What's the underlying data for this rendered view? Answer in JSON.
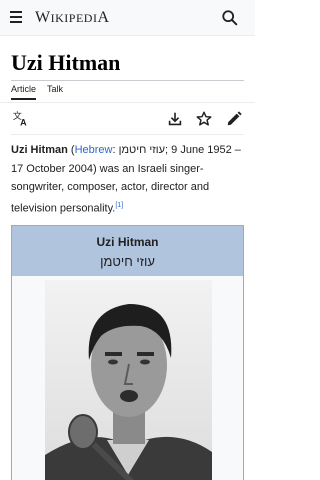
{
  "header": {
    "wordmark_big_w": "W",
    "wordmark_rest": "IKIPEDI",
    "wordmark_big_a": "A"
  },
  "page": {
    "title": "Uzi Hitman",
    "tabs": [
      {
        "label": "Article"
      },
      {
        "label": "Talk"
      }
    ]
  },
  "lead": {
    "name": "Uzi Hitman",
    "open_paren": " (",
    "language_link": "Hebrew",
    "after_language": ": ",
    "hebrew_name": "עוזי חיטמן",
    "dates": "; 9 June 1952 – 17 October 2004) was an Israeli singer-songwriter, composer, actor, director and television personality.",
    "citation": "[1]"
  },
  "infobox": {
    "name": "Uzi Hitman",
    "hebrew_name": "עוזי חיטמן"
  },
  "colors": {
    "link": "#3366cc",
    "infobox_header": "#b0c4de",
    "text": "#202122"
  }
}
